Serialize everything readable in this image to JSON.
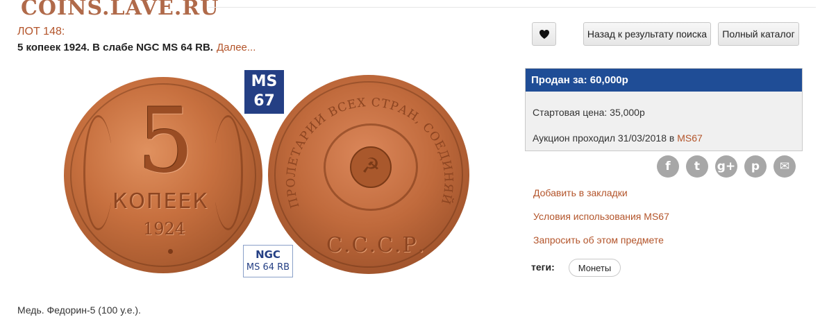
{
  "site": {
    "watermark": "COINS.LAVE.RU"
  },
  "lot": {
    "number_label": "ЛОТ 148:",
    "title": "5 копеек 1924. В слабе NGC MS 64 RB.",
    "more_link": "Далее...",
    "description": "Медь. Федорин-5 (100 у.е.)."
  },
  "photo": {
    "obverse": {
      "denomination": "5",
      "word": "КОПЕЕК",
      "year": "1924"
    },
    "reverse": {
      "legend": "ПРОЛЕТАРИИ ВСЕХ СТРАН, СОЕДИНЯЙТЕСЬ!",
      "country": "С.С.С.Р."
    },
    "ms_badge": {
      "line1": "MS",
      "line2": "67"
    },
    "ngc_badge": {
      "brand": "NGC",
      "grade": "MS 64 RB"
    }
  },
  "actions": {
    "favorite_icon": "heart-icon",
    "back_label": "Назад к результату поиска",
    "catalog_label": "Полный каталог"
  },
  "sale": {
    "sold_label": "Продан за: 60,000р",
    "start_label": "Стартовая цена: 35,000р",
    "auction_prefix": "Аукцион проходил 31/03/2018 в ",
    "auction_house": "MS67"
  },
  "social": [
    {
      "name": "facebook-icon",
      "glyph": "f"
    },
    {
      "name": "twitter-icon",
      "glyph": "t"
    },
    {
      "name": "google-plus-icon",
      "glyph": "g+"
    },
    {
      "name": "pinterest-icon",
      "glyph": "p"
    },
    {
      "name": "email-icon",
      "glyph": "✉"
    }
  ],
  "links": {
    "bookmark": "Добавить в закладки",
    "terms": "Условия использования MS67",
    "inquire": "Запросить об этом предмете"
  },
  "tags": {
    "label": "теги:",
    "items": [
      "Монеты"
    ]
  },
  "colors": {
    "accent": "#b3542a",
    "header_blue": "#1f4d96",
    "social_gray": "#a7a7a7"
  }
}
